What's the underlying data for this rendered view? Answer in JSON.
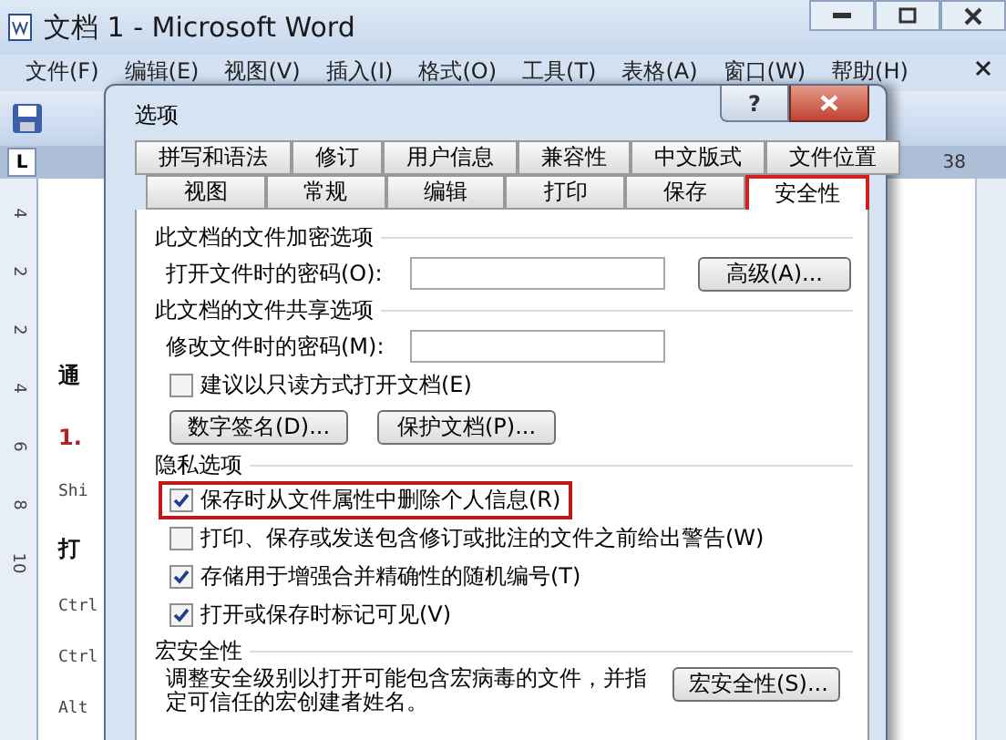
{
  "window": {
    "title": "文档 1 - Microsoft Word"
  },
  "menu": [
    "文件(F)",
    "编辑(E)",
    "视图(V)",
    "插入(I)",
    "格式(O)",
    "工具(T)",
    "表格(A)",
    "窗口(W)",
    "帮助(H)"
  ],
  "ruler": {
    "tab_marker": "L",
    "labels": [
      "38"
    ],
    "vertical_labels": [
      "4",
      "2",
      "2",
      "4",
      "6",
      "8",
      "10"
    ]
  },
  "document": {
    "lines": [
      {
        "text": "通",
        "kind": "heading"
      },
      {
        "text": "1.",
        "kind": "numbered"
      },
      {
        "text": "Shi",
        "kind": "code"
      },
      {
        "text": "打",
        "kind": "heading"
      },
      {
        "text": "Ctrl",
        "kind": "code"
      },
      {
        "text": "Ctrl",
        "kind": "code"
      },
      {
        "text": "Alt",
        "kind": "code"
      }
    ]
  },
  "dialog": {
    "title": "选项",
    "help": "?",
    "tab_rows": [
      [
        {
          "label": "拼写和语法",
          "selected": false,
          "highlighted": false
        },
        {
          "label": "修订",
          "selected": false,
          "highlighted": false
        },
        {
          "label": "用户信息",
          "selected": false,
          "highlighted": false
        },
        {
          "label": "兼容性",
          "selected": false,
          "highlighted": false
        },
        {
          "label": "中文版式",
          "selected": false,
          "highlighted": false
        },
        {
          "label": "文件位置",
          "selected": false,
          "highlighted": false
        }
      ],
      [
        {
          "label": "视图",
          "selected": false,
          "highlighted": false
        },
        {
          "label": "常规",
          "selected": false,
          "highlighted": false
        },
        {
          "label": "编辑",
          "selected": false,
          "highlighted": false
        },
        {
          "label": "打印",
          "selected": false,
          "highlighted": false
        },
        {
          "label": "保存",
          "selected": false,
          "highlighted": false
        },
        {
          "label": "安全性",
          "selected": true,
          "highlighted": true
        }
      ]
    ],
    "encryption": {
      "heading": "此文档的文件加密选项",
      "label": "打开文件时的密码(O):",
      "button": "高级(A)..."
    },
    "sharing": {
      "heading": "此文档的文件共享选项",
      "label": "修改文件时的密码(M):",
      "read_only": {
        "label": "建议以只读方式打开文档(E)",
        "checked": false
      },
      "buttons": [
        "数字签名(D)...",
        "保护文档(P)..."
      ]
    },
    "privacy": {
      "heading": "隐私选项",
      "options": [
        {
          "label": "保存时从文件属性中删除个人信息(R)",
          "checked": true,
          "highlighted": true
        },
        {
          "label": "打印、保存或发送包含修订或批注的文件之前给出警告(W)",
          "checked": false,
          "highlighted": false
        },
        {
          "label": "存储用于增强合并精确性的随机编号(T)",
          "checked": true,
          "highlighted": false
        },
        {
          "label": "打开或保存时标记可见(V)",
          "checked": true,
          "highlighted": false
        }
      ]
    },
    "macro": {
      "heading": "宏安全性",
      "text": "调整安全级别以打开可能包含宏病毒的文件，并指定可信任的宏创建者姓名。",
      "button": "宏安全性(S)..."
    }
  }
}
